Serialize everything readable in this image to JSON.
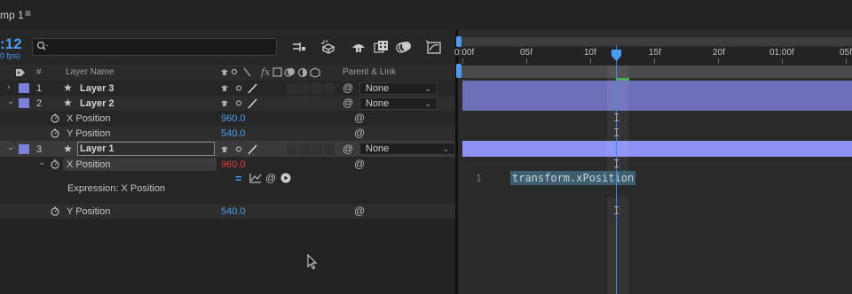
{
  "tab": {
    "title": "mp 1",
    "menu_glyph": "≡"
  },
  "toolbar": {
    "timecode": ":12",
    "fps": "0 fps)",
    "search_placeholder": "",
    "icons": [
      "search-icon",
      "composition-mini-flowchart-icon",
      "draft-3d-icon",
      "shy-layers-icon",
      "frame-blending-icon",
      "motion-blur-icon",
      "graph-editor-icon"
    ]
  },
  "columns": {
    "label_icon": "tag-icon",
    "number": "#",
    "layer_name": "Layer Name",
    "switches": "fx",
    "parent_link": "Parent & Link"
  },
  "layers": [
    {
      "number": "1",
      "name": "Layer 3",
      "parent": "None",
      "label_color": "#7b80d8"
    },
    {
      "number": "2",
      "name": "Layer 2",
      "parent": "None",
      "label_color": "#7b80d8"
    },
    {
      "number": "3",
      "name": "Layer 1",
      "parent": "None",
      "label_color": "#7b80d8"
    }
  ],
  "layer2_props": [
    {
      "name": "X Position",
      "value": "960.0"
    },
    {
      "name": "Y Position",
      "value": "540.0"
    }
  ],
  "layer1_props": {
    "x": {
      "name": "X Position",
      "value": "960.0"
    },
    "expression_label": "Expression: X Position",
    "y": {
      "name": "Y Position",
      "value": "540.0"
    }
  },
  "ruler": [
    "0:00f",
    "05f",
    "10f",
    "15f",
    "20f",
    "01:00f",
    "05f"
  ],
  "expression": {
    "line_number": "1",
    "code": "transform.xPosition"
  },
  "colors": {
    "accent": "#4d9bf4",
    "layer_bar": "#6c70b8",
    "selected_bar": "#8c91f2",
    "expression_value": "#dd3b3b"
  }
}
